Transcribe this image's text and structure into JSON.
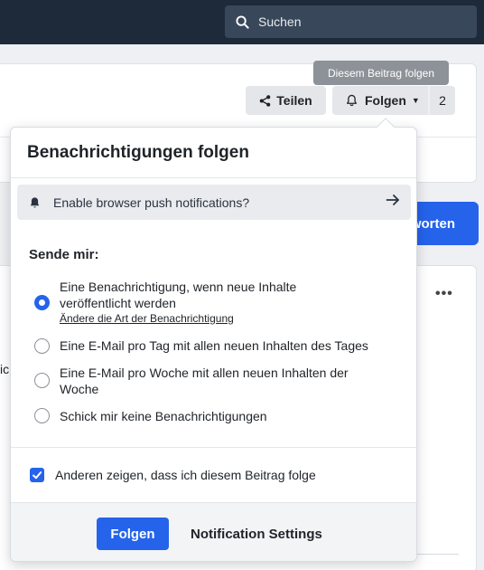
{
  "header": {
    "search_placeholder": "Suchen"
  },
  "post_actions": {
    "tooltip": "Diesem Beitrag folgen",
    "share_label": "Teilen",
    "follow_label": "Folgen",
    "follow_count": "2"
  },
  "background": {
    "reply_button_partial": "worten",
    "partial_text": "ic"
  },
  "popover": {
    "title": "Benachrichtigungen folgen",
    "push_prompt": "Enable browser push notifications?",
    "send_me_label": "Sende mir:",
    "options": [
      {
        "label": "Eine Benachrichtigung, wenn neue Inhalte veröffentlicht werden",
        "checked": true,
        "sub_link": "Ändere die Art der Benachrichtigung"
      },
      {
        "label": "Eine E-Mail pro Tag mit allen neuen Inhalten des Tages",
        "checked": false
      },
      {
        "label": "Eine E-Mail pro Woche mit allen neuen Inhalten der Woche",
        "checked": false
      },
      {
        "label": "Schick mir keine Benachrichtigungen",
        "checked": false
      }
    ],
    "show_others_label": "Anderen zeigen, dass ich diesem Beitrag folge",
    "show_others_checked": true,
    "primary_button": "Folgen",
    "secondary_button": "Notification Settings"
  },
  "icons": {
    "search": "search-icon",
    "share": "share-icon",
    "bell": "bell-icon",
    "arrow": "arrow-right-icon",
    "more": "more-horizontal-icon"
  },
  "colors": {
    "accent": "#2563eb",
    "topbar": "#1e2a3a"
  }
}
